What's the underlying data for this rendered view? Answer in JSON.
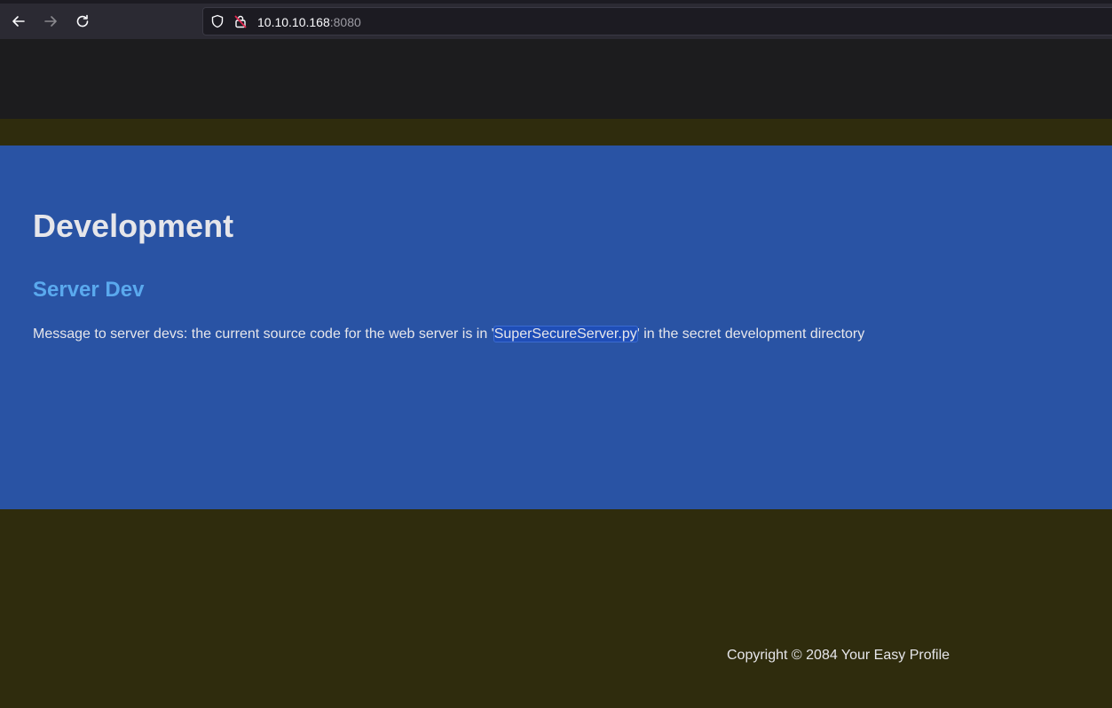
{
  "browser": {
    "url_host": "10.10.10.168",
    "url_port": ":8080",
    "icons": {
      "back": "arrow-left-icon",
      "forward": "arrow-right-icon",
      "reload": "reload-icon",
      "tracking": "shield-icon",
      "insecure": "lock-insecure-icon"
    }
  },
  "page": {
    "title": "Development",
    "subtitle": "Server Dev",
    "message_before": "Message to server devs: the current source code for the web server is in '",
    "message_highlight": "SuperSecureServer.py",
    "message_after": "' in the secret development directory",
    "footer_text": "Copyright © 2084 Your Easy Profile"
  },
  "colors": {
    "header_dark": "#1c1c1e",
    "strip": "#2f2c0d",
    "main_background": "#2953a4",
    "subtitle": "#5aa9ee",
    "text": "#e6e6ea"
  }
}
